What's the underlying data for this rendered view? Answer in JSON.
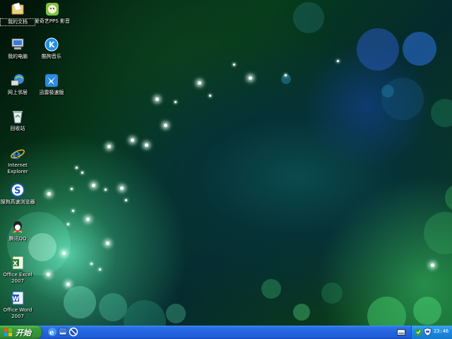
{
  "desktop": {
    "icons": [
      {
        "label": "我的文档",
        "icon": "my-documents-icon"
      },
      {
        "label": "爱奇艺PPS 影音",
        "icon": "iqiyi-pps-icon"
      },
      {
        "label": "我的电脑",
        "icon": "my-computer-icon"
      },
      {
        "label": "酷狗音乐",
        "icon": "kugou-music-icon"
      },
      {
        "label": "网上邻居",
        "icon": "network-places-icon"
      },
      {
        "label": "迅雷极速版",
        "icon": "xunlei-icon"
      },
      {
        "label": "回收站",
        "icon": "recycle-bin-icon"
      },
      {
        "label": "Internet Explorer",
        "icon": "internet-explorer-icon"
      },
      {
        "label": "搜狗高速浏览器",
        "icon": "sogou-browser-icon"
      },
      {
        "label": "腾讯QQ",
        "icon": "qq-icon"
      },
      {
        "label": "Office Excel 2007",
        "icon": "excel-icon"
      },
      {
        "label": "Office Word 2007",
        "icon": "word-icon"
      }
    ]
  },
  "taskbar": {
    "start_label": "开始",
    "quick_launch": [
      "ie-icon",
      "show-desktop-icon",
      "media-player-icon"
    ],
    "tray": {
      "clock": "23:46",
      "icons": [
        "keyboard-icon",
        "network-icon",
        "security-shield-icon"
      ]
    }
  },
  "colors": {
    "taskbar_blue": "#245edb",
    "start_green": "#3a9d3a",
    "tray_blue": "#1d8ae0"
  }
}
